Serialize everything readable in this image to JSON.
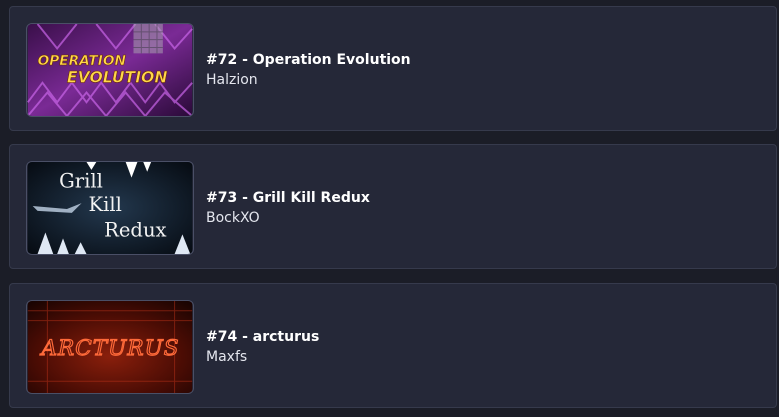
{
  "levels": [
    {
      "title": "#72 - Operation Evolution",
      "creator": "Halzion",
      "thumbnail": {
        "logo_line1": "OPERATION",
        "logo_line2": "EVOLUTION",
        "accent": "#b23fd6"
      }
    },
    {
      "title": "#73 - Grill Kill Redux",
      "creator": "BockXO",
      "thumbnail": {
        "logo_line1": "Grill",
        "logo_line2": "Kill",
        "logo_line3": "Redux",
        "accent": "#0a1522"
      }
    },
    {
      "title": "#74 - arcturus",
      "creator": "Maxfs",
      "thumbnail": {
        "logo": "ARCTURUS",
        "accent": "#c2331a"
      }
    }
  ]
}
